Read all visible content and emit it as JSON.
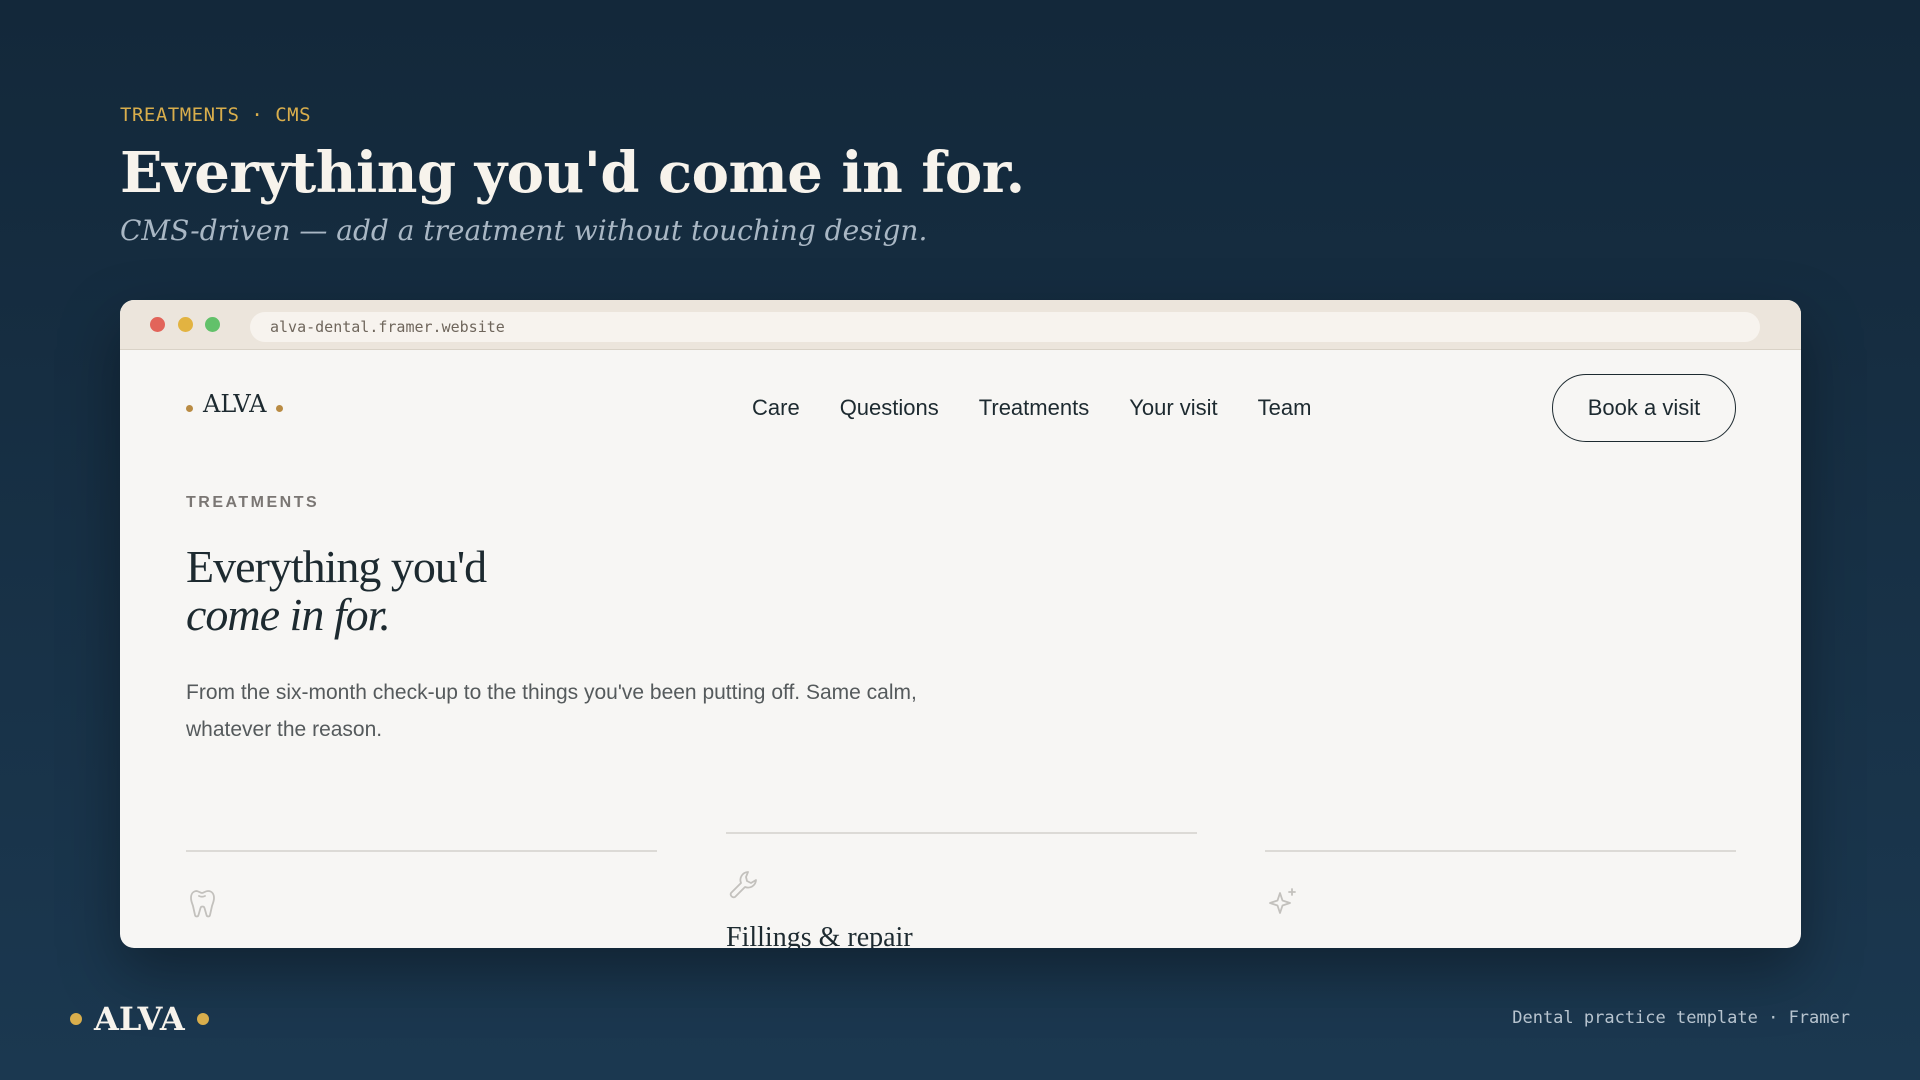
{
  "slide": {
    "eyebrow": "TREATMENTS · CMS",
    "title": "Everything you'd come in for.",
    "subtitle": "CMS-driven — add a treatment without touching design."
  },
  "browser": {
    "url": "alva-dental.framer.website"
  },
  "site": {
    "logo": "ALVA",
    "nav": [
      "Care",
      "Questions",
      "Treatments",
      "Your visit",
      "Team"
    ],
    "cta": "Book a visit",
    "kicker": "TREATMENTS",
    "heading_line1": "Everything you'd",
    "heading_line2": "come in for.",
    "lead": "From the six-month check-up to the things you've been putting off. Same calm, whatever the reason.",
    "cards": [
      {
        "icon": "tooth-icon",
        "title": ""
      },
      {
        "icon": "wrench-icon",
        "title": "Fillings & repair"
      },
      {
        "icon": "sparkle-icon",
        "title": ""
      }
    ]
  },
  "footer": {
    "logo": "ALVA",
    "note": "Dental practice template · Framer"
  },
  "colors": {
    "accent_gold": "#d9ae4c",
    "background_navy": "#13283a",
    "site_background": "#f7f6f4",
    "ink": "#1d2a30"
  }
}
